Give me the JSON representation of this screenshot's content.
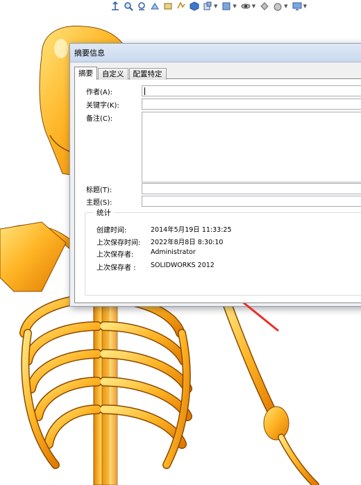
{
  "dialog": {
    "title": "摘要信息",
    "tabs": [
      {
        "label": "摘要",
        "active": true
      },
      {
        "label": "自定义",
        "active": false
      },
      {
        "label": "配置特定",
        "active": false
      }
    ],
    "fields": {
      "author": {
        "label": "作者(A):",
        "value": ""
      },
      "keywords": {
        "label": "关键字(K):",
        "value": ""
      },
      "comments": {
        "label": "备注(C):",
        "value": ""
      },
      "title": {
        "label": "标题(T):",
        "value": ""
      },
      "subject": {
        "label": "主题(S):",
        "value": ""
      }
    },
    "stats": {
      "heading": "统计",
      "rows": [
        {
          "label": "创建时间:",
          "value": "2014年5月19日 11:33:25"
        },
        {
          "label": "上次保存时间:",
          "value": "2022年8月8日 8:30:10"
        },
        {
          "label": "上次保存者:",
          "value": "Administrator"
        },
        {
          "label": "上次保存者 :",
          "value": "SOLIDWORKS 2012"
        }
      ]
    }
  },
  "toolbar": {
    "icons": [
      "zoom-to-fit-icon",
      "zoom-area-icon",
      "previous-view-icon",
      "section-view-icon",
      "dynamic-annotation-icon",
      "view-orientation-icon",
      "display-style-icon",
      "hide-show-icon",
      "edit-appearance-icon",
      "apply-scene-icon",
      "view-settings-icon"
    ]
  },
  "colors": {
    "bone": "#f7a51c",
    "bone_highlight": "#ffe07a",
    "annotation_arrow": "#e8302a"
  }
}
